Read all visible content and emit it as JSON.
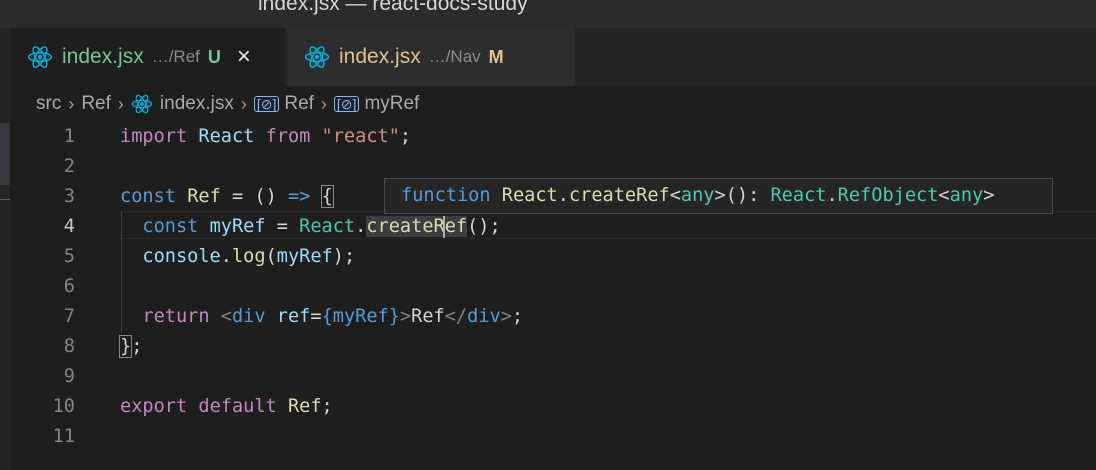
{
  "window": {
    "title": "index.jsx — react-docs-study"
  },
  "tabs": [
    {
      "name": "index.jsx",
      "dir": "…/Ref",
      "status": "U",
      "close": "×"
    },
    {
      "name": "index.jsx",
      "dir": "…/Nav",
      "status": "M"
    }
  ],
  "breadcrumb": {
    "folder": "src",
    "sub": "Ref",
    "file": "index.jsx",
    "symbol1": "Ref",
    "symbol2": "myRef",
    "sep": "›"
  },
  "editor": {
    "current_line": 4,
    "line_numbers": [
      "1",
      "2",
      "3",
      "4",
      "5",
      "6",
      "7",
      "8",
      "9",
      "10",
      "11"
    ],
    "tokens": {
      "import": "import",
      "React": "React",
      "from": "from",
      "react_str": "\"react\"",
      "semi": ";",
      "const": "const",
      "Ref": "Ref",
      "eq": " = ",
      "arrow_head": "() ",
      "arrow": "=>",
      "brace_open": "{",
      "myRef": "myRef",
      "dot": ".",
      "createRef_a": "creat",
      "createRef_b": "eRef",
      "parens": "()",
      "console": "console",
      "log": "log",
      "lp": "(",
      "rp": ")",
      "return": "return",
      "lt": "<",
      "div": "div",
      "refAttr": "ref",
      "attrEq": "=",
      "jsx_expr": "{myRef}",
      "gt": ">",
      "text_Ref": "Ref",
      "close_lt": "</",
      "brace_close": "}",
      "export": "export",
      "default": "default"
    }
  },
  "hover": {
    "keyword": "function",
    "ns": "React",
    "fn": "createRef",
    "lt": "<",
    "generic": "any",
    "gt": ">",
    "call": "(): ",
    "type_ns": "React",
    "type_name": "RefObject"
  },
  "colors": {
    "untracked": "#73c991",
    "modified": "#e2c08d",
    "keyword": "#c586c0",
    "storage": "#569cd6",
    "variable": "#9cdcfe",
    "class": "#4ec9b0",
    "function": "#dcdcaa",
    "string": "#ce9178"
  },
  "icons": [
    "react-icon",
    "close-icon",
    "chevron-right-icon",
    "symbol-variable-icon"
  ]
}
